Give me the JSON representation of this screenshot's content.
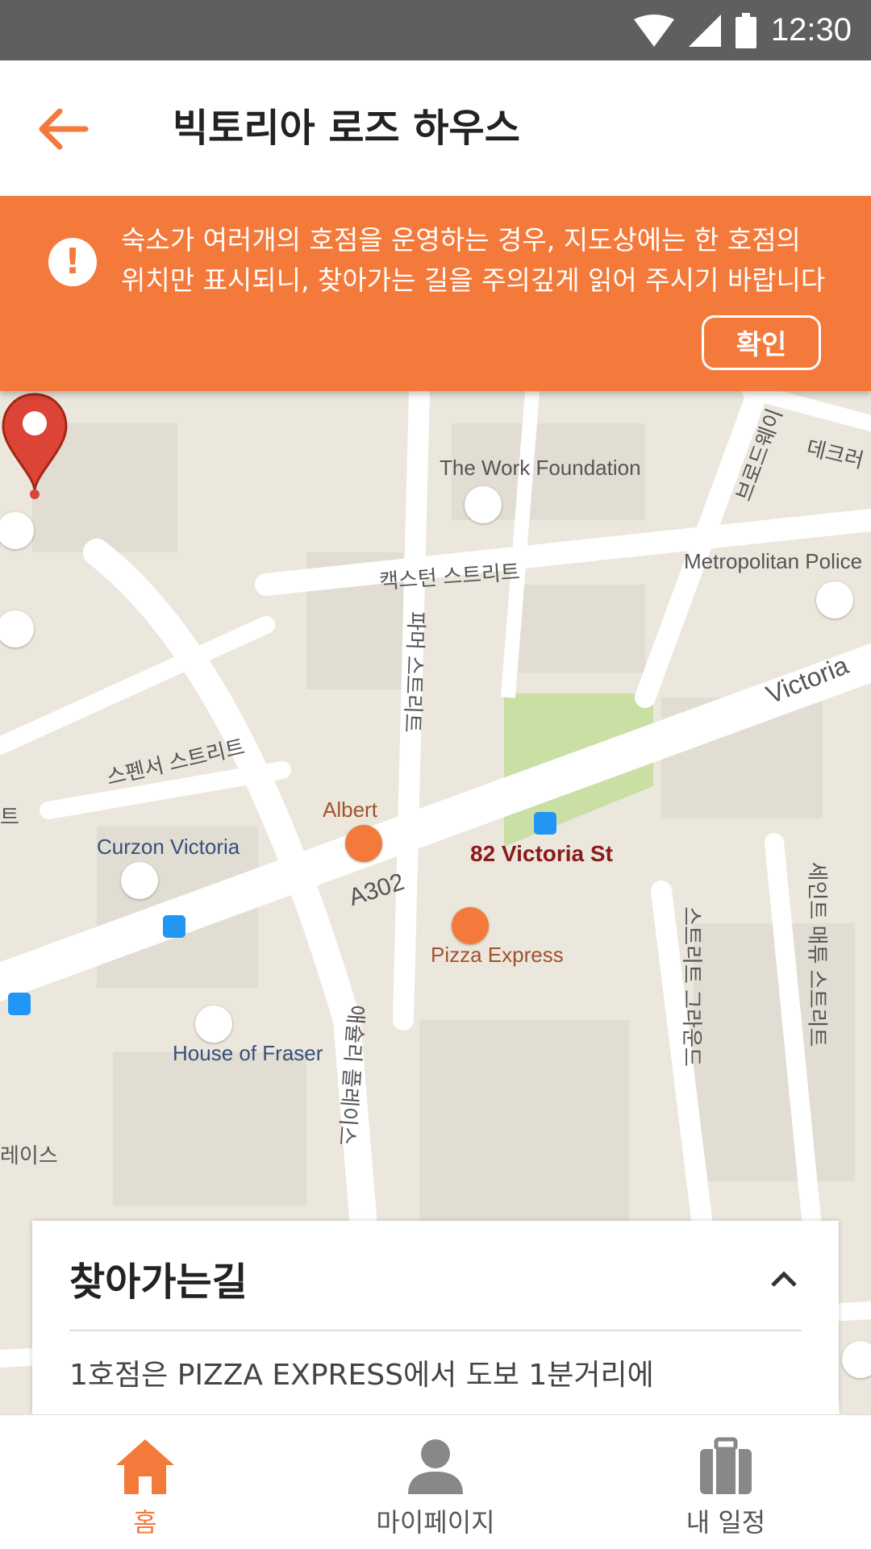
{
  "status_bar": {
    "time": "12:30"
  },
  "header": {
    "title": "빅토리아 로즈 하우스"
  },
  "notice": {
    "line1": "숙소가 여러개의 호점을 운영하는 경우, 지도상에는 한 호점의",
    "line2": "위치만 표시되니, 찾아가는 길을 주의깊게 읽어 주시기 바랍니다",
    "confirm_label": "확인"
  },
  "map": {
    "labels": {
      "work_foundation": "The Work Foundation",
      "metropolitan": "Metropolitan Police",
      "caxton": "캑스턴 스트리트",
      "spencer": "스펜서 스트리트",
      "palmer": "파머 스트리트",
      "victoria": "Victoria",
      "albert": "Albert",
      "curzon": "Curzon Victoria",
      "a302": "A302",
      "pizza": "Pizza Express",
      "fraser": "House of Fraser",
      "st_ann": "세인트 매튜 스트리트",
      "strutton": "스트리트 그라운드",
      "broadway": "브로드웨이",
      "declaration": "데크러",
      "ashley": "애슐리 플레이스",
      "place": "레이스",
      "left_frag": "트"
    },
    "address": "82 Victoria St"
  },
  "directions": {
    "title": "찾아가는길",
    "text": "1호점은 PIZZA EXPRESS에서 도보 1분거리에"
  },
  "nav": {
    "home": "홈",
    "mypage": "마이페이지",
    "schedule": "내 일정"
  },
  "colors": {
    "accent": "#f47a3c",
    "pin": "#db4437"
  }
}
